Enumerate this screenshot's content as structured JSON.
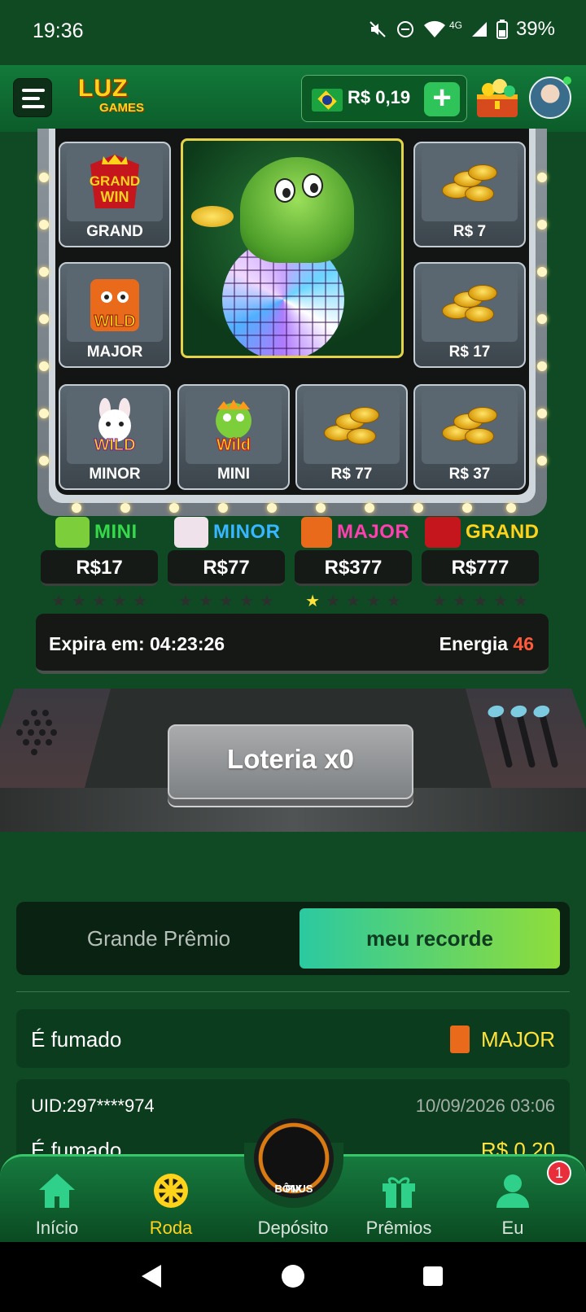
{
  "status": {
    "time": "19:36",
    "network": "4G",
    "battery": "39%"
  },
  "header": {
    "logo_top": "LUZ",
    "logo_bottom": "GAMES",
    "balance": "R$ 0,19",
    "add": "+"
  },
  "grid": {
    "cells": [
      {
        "label": "GRAND",
        "art": "grand-win-icon"
      },
      {
        "label": "R$ 7",
        "art": "coins-icon"
      },
      {
        "label": "MAJOR",
        "art": "tiger-wild-icon"
      },
      {
        "label": "R$ 17",
        "art": "coins-icon"
      },
      {
        "label": "MINOR",
        "art": "rabbit-wild-icon"
      },
      {
        "label": "MINI",
        "art": "dragon-wild-icon"
      },
      {
        "label": "R$ 77",
        "art": "coins-icon"
      },
      {
        "label": "R$ 37",
        "art": "coins-icon"
      }
    ],
    "center_art": "dragon-disco-icon"
  },
  "jackpots": [
    {
      "name": "MINI",
      "value": "R$17",
      "stars_on": 0,
      "color": "#35d94a"
    },
    {
      "name": "MINOR",
      "value": "R$77",
      "stars_on": 0,
      "color": "#37b7ff"
    },
    {
      "name": "MAJOR",
      "value": "R$377",
      "stars_on": 1,
      "color": "#ff3fb0"
    },
    {
      "name": "GRAND",
      "value": "R$777",
      "stars_on": 0,
      "color": "#ffd31a"
    }
  ],
  "expire": {
    "label": "Expira em: 04:23:26",
    "energy_label": "Energia",
    "energy_value": "46"
  },
  "lottery_button": "Loteria x0",
  "tabs": {
    "tab1": "Grande Prêmio",
    "tab2": "meu recorde"
  },
  "records": [
    {
      "left": "É fumado",
      "right": "MAJOR"
    },
    {
      "uid": "UID:297****974",
      "date": "10/09/2026 03:06",
      "left": "É fumado",
      "right": "R$ 0,20"
    }
  ],
  "nav": {
    "inicio": "Início",
    "roda": "Roda",
    "deposito": "Depósito",
    "premios": "Prêmios",
    "eu": "Eu",
    "badge": "1",
    "pix_line1": "PIX",
    "pix_line2": "BÔNUS"
  },
  "colors": {
    "accent_green": "#2fc45a",
    "yellow": "#ffe23a",
    "energy": "#ff5a3a"
  }
}
